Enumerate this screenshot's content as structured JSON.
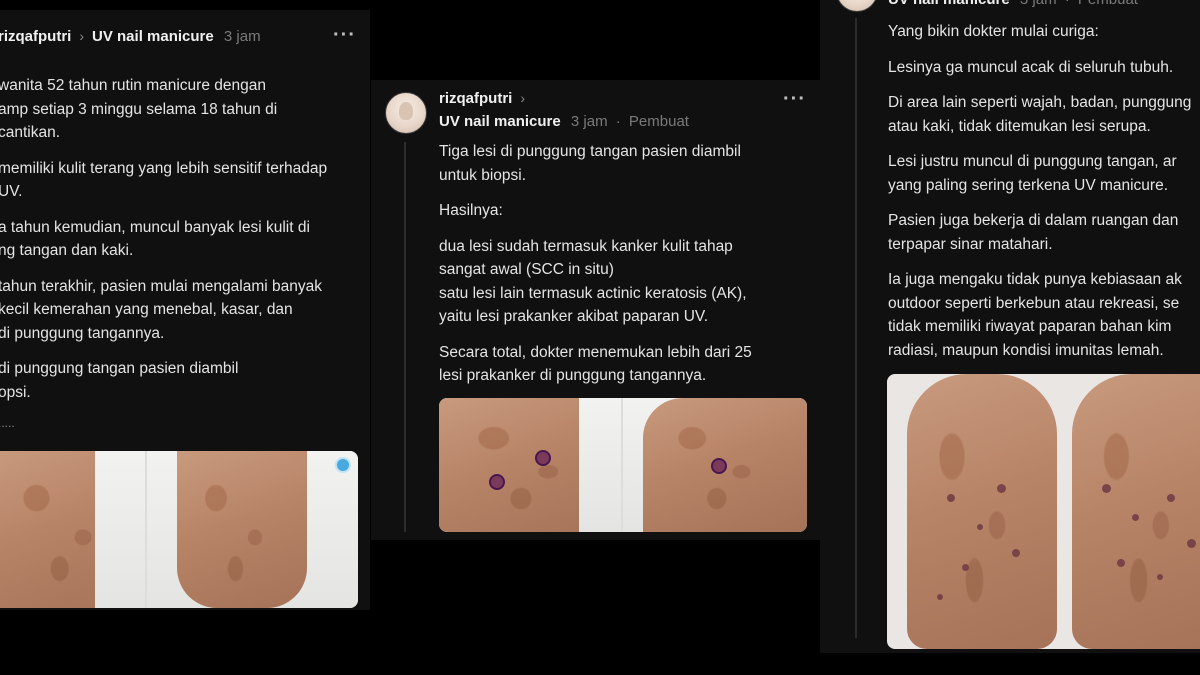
{
  "colors": {
    "background": "#000000",
    "panel": "#101010",
    "text": "#e4e4e4",
    "meta": "#7a7a7a"
  },
  "left_post": {
    "username": "rizqafputri",
    "topic": "UV nail manicure",
    "time": "3 jam",
    "lines": [
      "wanita 52 tahun rutin manicure dengan",
      "amp setiap 3 minggu selama 18 tahun di",
      "cantikan.",
      "memiliki kulit terang yang lebih sensitif terhadap",
      "UV.",
      "a tahun kemudian, muncul banyak lesi kulit di",
      "ng tangan dan kaki.",
      "tahun terakhir, pasien mulai mengalami banyak",
      "kecil kemerahan yang menebal, kasar, dan",
      "di punggung tangannya.",
      "di punggung tangan pasien diambil",
      "opsi."
    ],
    "ellipsis": "....."
  },
  "middle_post": {
    "username": "rizqafputri",
    "topic": "UV nail manicure",
    "time": "3 jam",
    "badge": "Pembuat",
    "lines": [
      "Tiga lesi di punggung tangan pasien diambil",
      "untuk biopsi.",
      "Hasilnya:",
      "dua lesi sudah termasuk kanker kulit tahap",
      "sangat awal (SCC in situ)",
      "satu lesi lain termasuk actinic keratosis (AK),",
      "yaitu lesi prakanker akibat paparan UV.",
      "Secara total, dokter menemukan lebih dari 25",
      "lesi prakanker di punggung tangannya."
    ]
  },
  "right_post": {
    "topic": "UV nail manicure",
    "time": "3 jam",
    "badge": "Pembuat",
    "lines": [
      "Yang bikin dokter mulai curiga:",
      "Lesinya ga muncul acak di seluruh tubuh.",
      "Di area lain seperti wajah, badan, punggung",
      "atau kaki, tidak ditemukan lesi serupa.",
      "Lesi justru muncul di punggung tangan, ar",
      "yang paling sering terkena UV manicure.",
      "Pasien juga bekerja di dalam ruangan dan",
      "terpapar sinar matahari.",
      "Ia juga mengaku tidak punya kebiasaan ak",
      "outdoor seperti berkebun atau rekreasi, se",
      "tidak memiliki riwayat paparan bahan kim",
      "radiasi, maupun kondisi imunitas lemah."
    ]
  },
  "icons": {
    "more": "more-options-icon",
    "chevron": "chevron-right-icon"
  }
}
